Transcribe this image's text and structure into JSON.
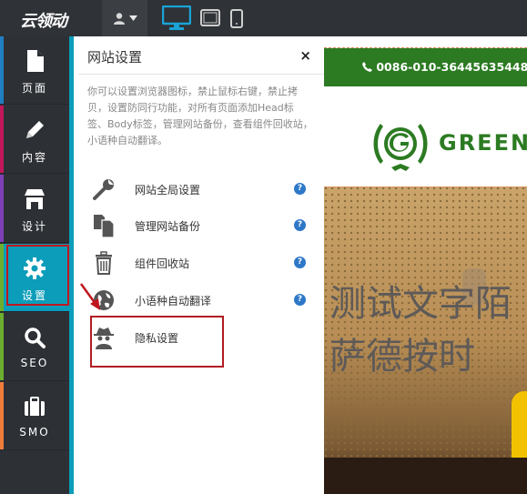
{
  "topbar": {
    "logo_text": "云领动",
    "user_icon": "user-icon",
    "devices": [
      "desktop-icon",
      "tablet-icon",
      "mobile-icon"
    ]
  },
  "sidebar": {
    "items": [
      {
        "label": "页面",
        "icon": "page-icon",
        "color": "#1f7fc2"
      },
      {
        "label": "内容",
        "icon": "pencil-icon",
        "color": "#c2185b"
      },
      {
        "label": "设计",
        "icon": "store-icon",
        "color": "#7e3fb8"
      },
      {
        "label": "设置",
        "icon": "gear-icon",
        "color": "#0b9db9",
        "active": true
      },
      {
        "label": "SEO",
        "icon": "search-icon",
        "color": "#6cae2f"
      },
      {
        "label": "SMO",
        "icon": "briefcase-icon",
        "color": "#f07c3c"
      }
    ]
  },
  "panel": {
    "title": "网站设置",
    "close": "×",
    "description": "你可以设置浏览器图标，禁止鼠标右键，禁止拷贝，设置防同行功能，对所有页面添加Head标签、Body标签，管理网站备份，查看组件回收站，小语种自动翻译。",
    "items": [
      {
        "label": "网站全局设置",
        "icon": "wrench-icon",
        "help": "?"
      },
      {
        "label": "管理网站备份",
        "icon": "backup-icon",
        "help": "?"
      },
      {
        "label": "组件回收站",
        "icon": "trash-icon",
        "help": "?"
      },
      {
        "label": "小语种自动翻译",
        "icon": "globe-icon",
        "help": "?"
      },
      {
        "label": "隐私设置",
        "icon": "spy-icon"
      }
    ]
  },
  "preview": {
    "phone": "0086-010-36445635448",
    "logo_text": "GREEN",
    "hero_text_line1": "测试文字陌",
    "hero_text_line2": "萨德按时"
  },
  "colors": {
    "accent": "#0b9db9",
    "brand_green": "#2c7b22",
    "highlight_red": "#c0171f"
  }
}
